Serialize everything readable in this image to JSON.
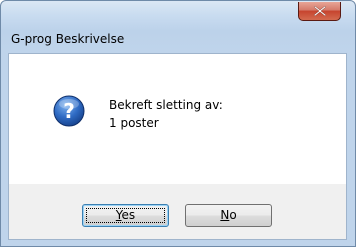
{
  "window": {
    "title": "G-prog Beskrivelse"
  },
  "titlebar": {
    "close_icon": "close-icon"
  },
  "message": {
    "icon": "question-icon",
    "line1": "Bekreft sletting av:",
    "line2": "1 poster"
  },
  "buttons": {
    "yes": {
      "mnemonic": "Y",
      "rest": "es"
    },
    "no": {
      "mnemonic": "N",
      "rest": "o"
    }
  },
  "colors": {
    "close_button": "#c6442e",
    "question_icon": "#2f6bc4",
    "default_button_border": "#3c7fb1"
  }
}
